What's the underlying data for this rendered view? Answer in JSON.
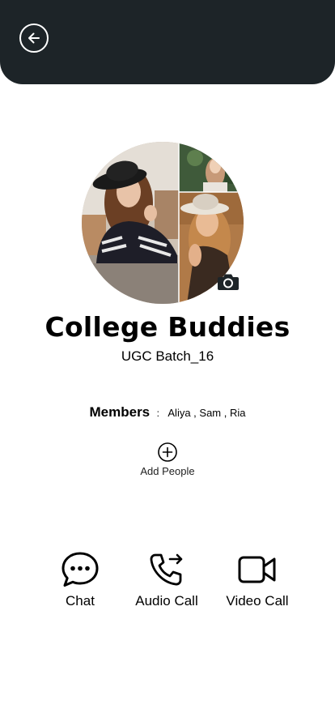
{
  "header": {
    "back_icon": "arrow-left-circle-icon",
    "background": "#1d2428"
  },
  "group": {
    "name": "College Buddies",
    "subtitle": "UGC Batch_16",
    "camera_icon": "camera-icon"
  },
  "members": {
    "label": "Members",
    "separator": ":",
    "names": "Aliya , Sam , Ria"
  },
  "add_people": {
    "label": "Add People",
    "icon": "plus-circle-icon"
  },
  "actions": [
    {
      "label": "Chat",
      "icon": "chat-bubble-icon"
    },
    {
      "label": "Audio Call",
      "icon": "phone-outgoing-icon"
    },
    {
      "label": "Video Call",
      "icon": "video-camera-icon"
    }
  ]
}
